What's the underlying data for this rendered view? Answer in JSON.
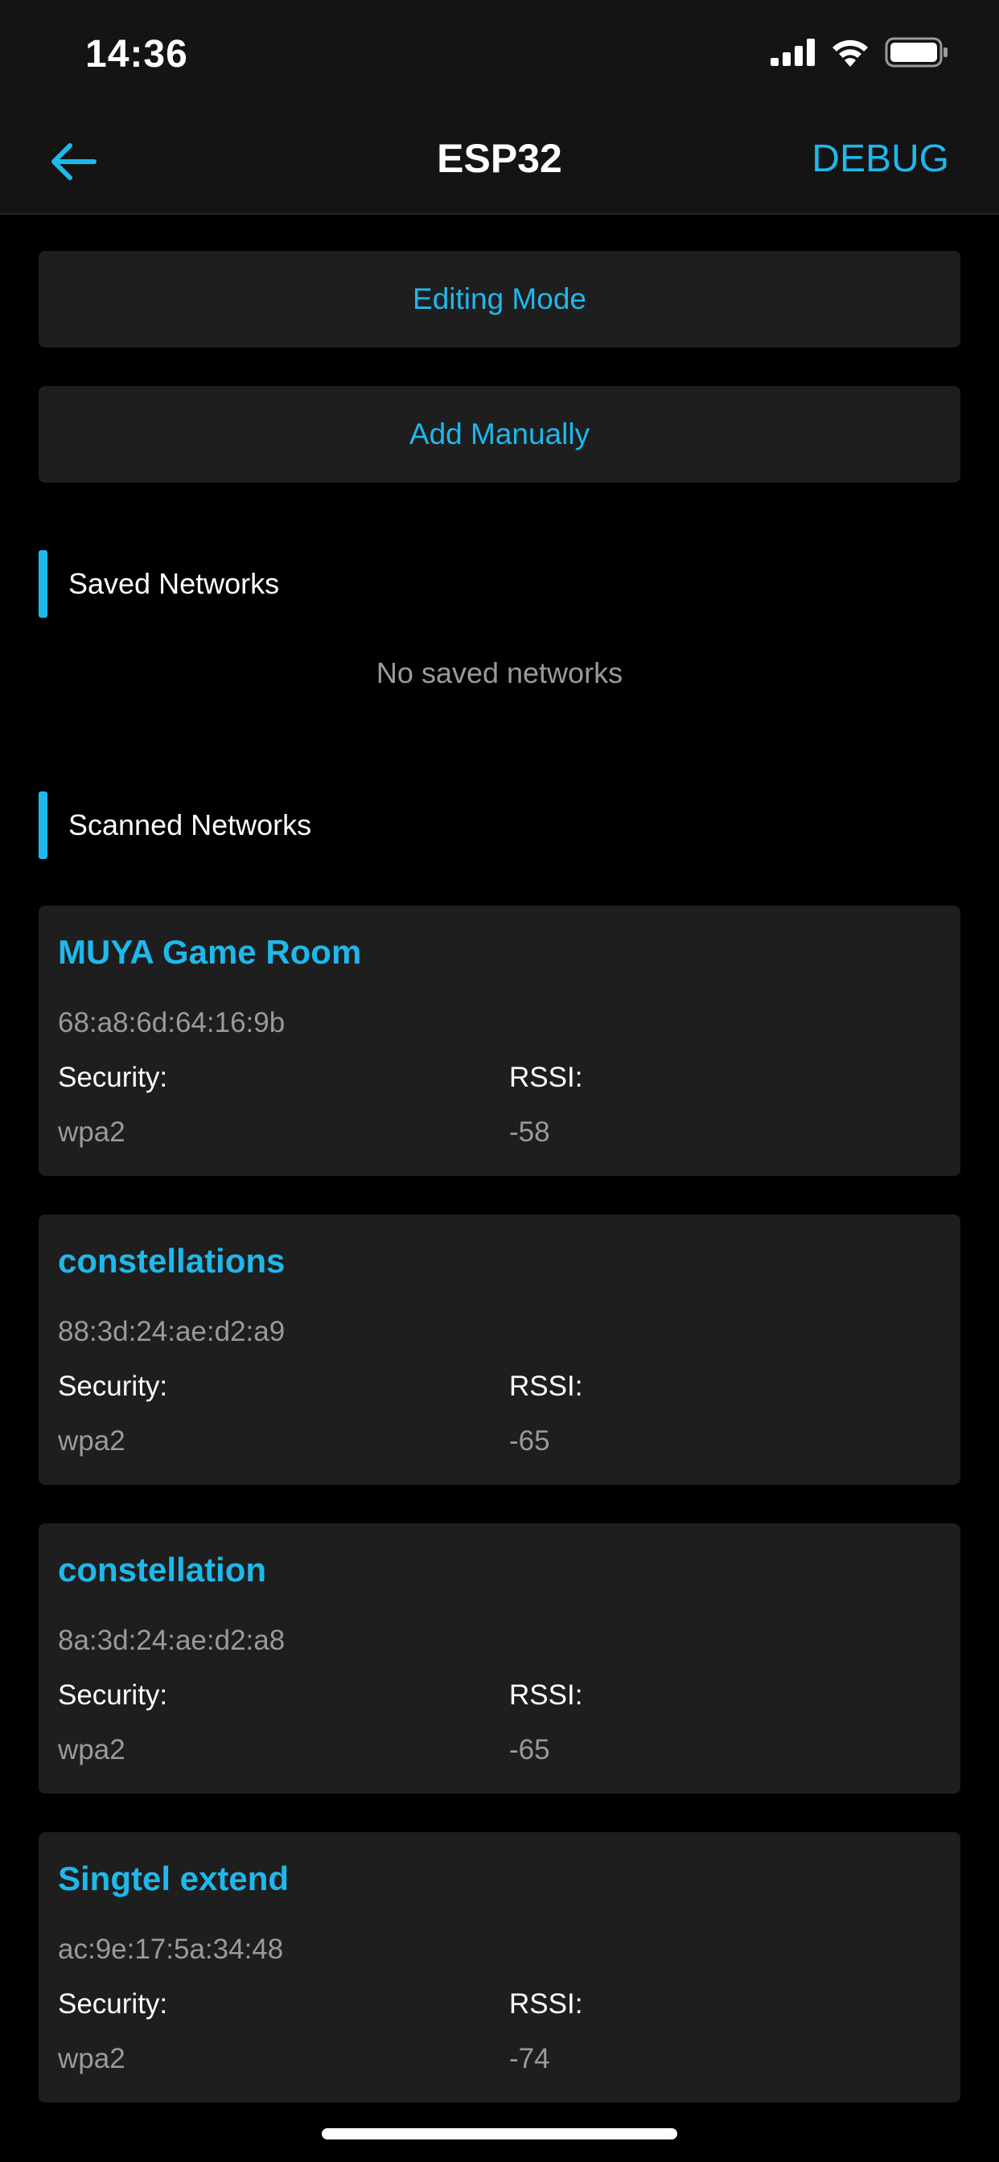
{
  "status_bar": {
    "time": "14:36",
    "icons": [
      "cellular-signal-icon",
      "wifi-icon",
      "battery-icon"
    ]
  },
  "nav": {
    "back_icon": "arrow-left-icon",
    "title": "ESP32",
    "debug_label": "DEBUG"
  },
  "actions": {
    "editing_mode_label": "Editing Mode",
    "add_manually_label": "Add Manually"
  },
  "saved_networks": {
    "title": "Saved Networks",
    "empty_text": "No saved networks"
  },
  "scanned_networks": {
    "title": "Scanned Networks",
    "security_label": "Security:",
    "rssi_label": "RSSI:",
    "items": [
      {
        "name": "MUYA Game Room",
        "mac": "68:a8:6d:64:16:9b",
        "security": "wpa2",
        "rssi": "-58"
      },
      {
        "name": "constellations",
        "mac": "88:3d:24:ae:d2:a9",
        "security": "wpa2",
        "rssi": "-65"
      },
      {
        "name": "constellation",
        "mac": "8a:3d:24:ae:d2:a8",
        "security": "wpa2",
        "rssi": "-65"
      },
      {
        "name": "Singtel extend",
        "mac": "ac:9e:17:5a:34:48",
        "security": "wpa2",
        "rssi": "-74"
      }
    ]
  },
  "colors": {
    "accent": "#1fb8ea",
    "background": "#000000",
    "card": "#1e1e1f",
    "bar": "#141414",
    "muted_text": "#9a9a9a"
  }
}
